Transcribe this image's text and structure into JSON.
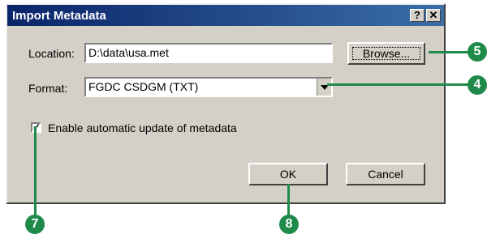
{
  "window": {
    "title": "Import Metadata",
    "help_glyph": "?",
    "close_glyph": "✕"
  },
  "form": {
    "location_label": "Location:",
    "location_value": "D:\\data\\usa.met",
    "browse_label": "Browse...",
    "format_label": "Format:",
    "format_value": "FGDC CSDGM (TXT)",
    "checkbox_checked": true,
    "checkbox_label": "Enable automatic update of metadata"
  },
  "buttons": {
    "ok_label": "OK",
    "cancel_label": "Cancel"
  },
  "callouts": [
    "5",
    "4",
    "7",
    "8"
  ],
  "colors": {
    "callout": "#1f8a4a",
    "titlebar": "#0a246a",
    "dialog_bg": "#d4d0c8"
  }
}
